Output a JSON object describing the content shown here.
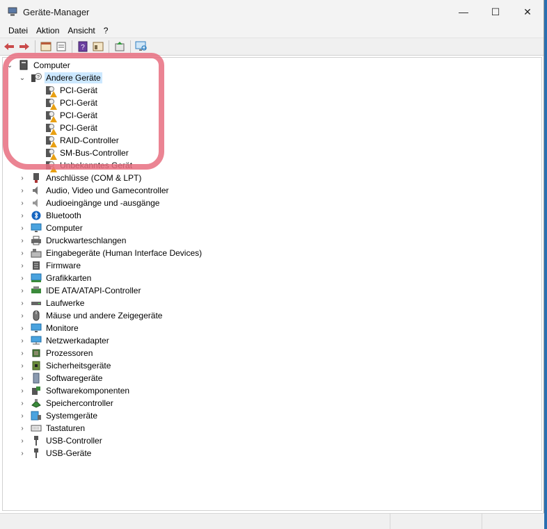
{
  "window": {
    "title": "Geräte-Manager",
    "controls": {
      "minimize": "—",
      "maximize": "☐",
      "close": "✕"
    }
  },
  "menu": [
    "Datei",
    "Aktion",
    "Ansicht",
    "?"
  ],
  "toolbar": {
    "icons": [
      "back-arrow-icon",
      "forward-arrow-icon",
      "show-hide-tree-icon",
      "properties-icon",
      "help-icon",
      "view-icon",
      "update-driver-icon",
      "scan-hardware-icon"
    ]
  },
  "tree": {
    "root": "Computer",
    "expanded_category": {
      "label": "Andere Geräte",
      "children": [
        "PCI-Gerät",
        "PCI-Gerät",
        "PCI-Gerät",
        "PCI-Gerät",
        "RAID-Controller",
        "SM-Bus-Controller",
        "Unbekanntes Gerät"
      ]
    },
    "categories": [
      "Anschlüsse (COM & LPT)",
      "Audio, Video und Gamecontroller",
      "Audioeingänge und -ausgänge",
      "Bluetooth",
      "Computer",
      "Druckwarteschlangen",
      "Eingabegeräte (Human Interface Devices)",
      "Firmware",
      "Grafikkarten",
      "IDE ATA/ATAPI-Controller",
      "Laufwerke",
      "Mäuse und andere Zeigegeräte",
      "Monitore",
      "Netzwerkadapter",
      "Prozessoren",
      "Sicherheitsgeräte",
      "Softwaregeräte",
      "Softwarekomponenten",
      "Speichercontroller",
      "Systemgeräte",
      "Tastaturen",
      "USB-Controller",
      "USB-Geräte"
    ]
  },
  "colors": {
    "selection": "#cce8ff",
    "annotation_highlight": "#e86e80",
    "warning": "#e8a013",
    "bluetooth": "#1565c0"
  }
}
